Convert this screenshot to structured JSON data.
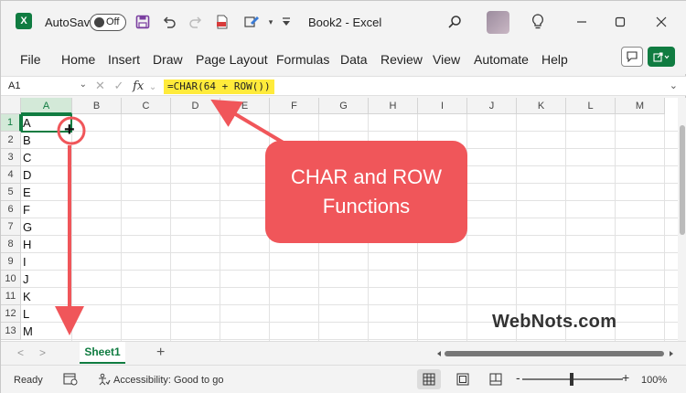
{
  "titlebar": {
    "app_logo": "X",
    "autosave_label": "AutoSave",
    "autosave_state": "Off",
    "doc_title": "Book2",
    "separator": "-",
    "app_name": "Excel"
  },
  "ribbon": {
    "tabs": [
      "File",
      "Home",
      "Insert",
      "Draw",
      "Page Layout",
      "Formulas",
      "Data",
      "Review",
      "View",
      "Automate",
      "Help"
    ]
  },
  "formula_bar": {
    "name_box": "A1",
    "fx": "fx",
    "formula": "=CHAR(64 + ROW())"
  },
  "grid": {
    "columns": [
      "A",
      "B",
      "C",
      "D",
      "E",
      "F",
      "G",
      "H",
      "I",
      "J",
      "K",
      "L",
      "M"
    ],
    "rows": [
      "1",
      "2",
      "3",
      "4",
      "5",
      "6",
      "7",
      "8",
      "9",
      "10",
      "11",
      "12",
      "13"
    ],
    "column_a_values": [
      "A",
      "B",
      "C",
      "D",
      "E",
      "F",
      "G",
      "H",
      "I",
      "J",
      "K",
      "L",
      "M"
    ]
  },
  "annotation": {
    "callout_line1": "CHAR and ROW",
    "callout_line2": "Functions",
    "fill_handle_glyph": "+",
    "watermark": "WebNots.com",
    "accent_color": "#f0565a"
  },
  "sheets": {
    "tabs": [
      "Sheet1"
    ],
    "add_glyph": "+",
    "prev_glyph": "<",
    "next_glyph": ">"
  },
  "status": {
    "ready": "Ready",
    "accessibility": "Accessibility: Good to go",
    "zoom_minus": "-",
    "zoom_plus": "+",
    "zoom": "100%"
  },
  "colors": {
    "brand": "#107c41",
    "formula_highlight": "#ffeb3b"
  }
}
